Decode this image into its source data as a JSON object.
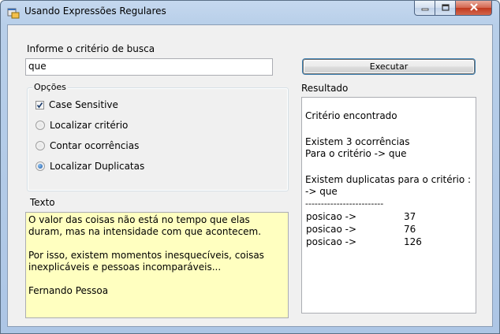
{
  "window": {
    "title": "Usando Expressões Regulares",
    "icon": "form-icon",
    "controls": [
      "minimize-icon",
      "maximize-icon",
      "close-icon"
    ]
  },
  "search": {
    "label": "Informe o critério de busca",
    "value": "que"
  },
  "options": {
    "legend": "Opções",
    "case_sensitive": {
      "label": "Case Sensitive",
      "checked": true
    },
    "radios": [
      {
        "label": "Localizar critério",
        "selected": false
      },
      {
        "label": "Contar ocorrências",
        "selected": false
      },
      {
        "label": "Localizar Duplicatas",
        "selected": true
      }
    ]
  },
  "texto": {
    "label": "Texto",
    "content": "O valor das coisas não está no tempo que elas\nduram, mas na intensidade com que acontecem.\n\nPor isso, existem momentos inesquecíveis, coisas\ninexplicáveis e pessoas incomparáveis...\n\nFernando Pessoa"
  },
  "executar": {
    "label": "Executar"
  },
  "resultado": {
    "label": "Resultado",
    "line1": "Critério encontrado",
    "line2": "Existem 3 ocorrências",
    "line3": "Para o critério -> que",
    "line4": "Existem duplicatas para o critério :",
    "line5": "-> que",
    "separator": "-------------------------",
    "positions": [
      {
        "label": "posicao ->",
        "value": "37"
      },
      {
        "label": "posicao ->",
        "value": "76"
      },
      {
        "label": "posicao ->",
        "value": "126"
      }
    ]
  }
}
